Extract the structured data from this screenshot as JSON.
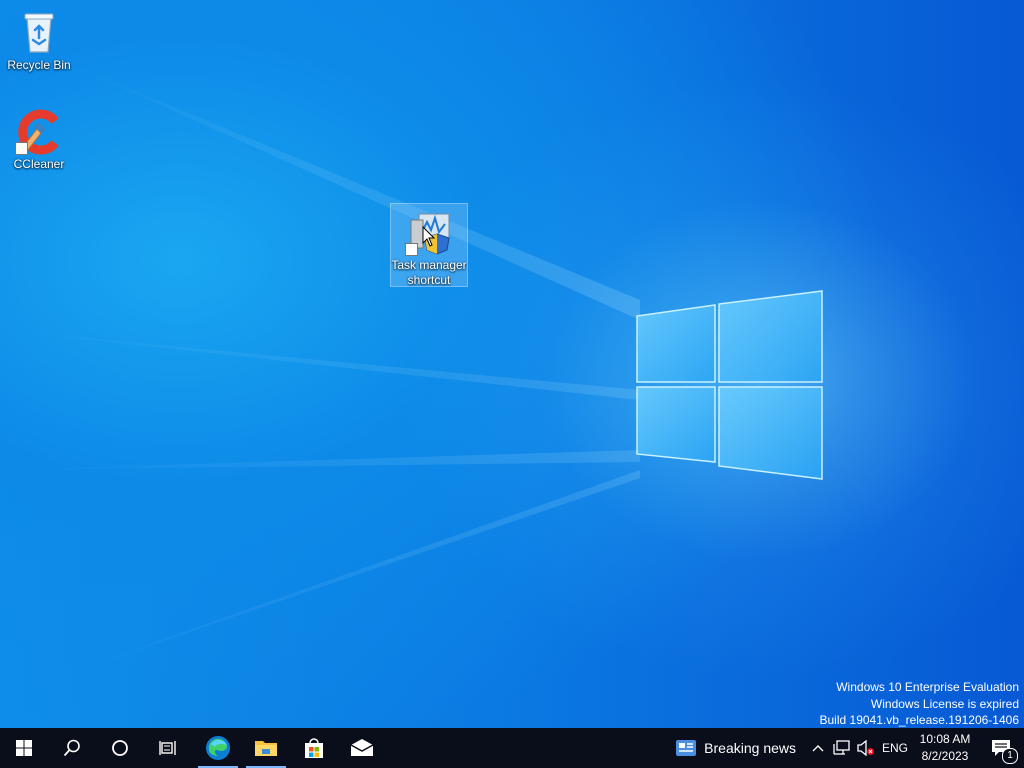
{
  "desktop": {
    "icons": [
      {
        "label": "Recycle Bin",
        "icon": "recycle-bin-icon"
      },
      {
        "label": "CCleaner",
        "icon": "ccleaner-icon"
      },
      {
        "label": "Task manager shortcut",
        "icon": "task-manager-icon"
      }
    ],
    "watermark": {
      "line1": "Windows 10 Enterprise Evaluation",
      "line2": "Windows License is expired",
      "line3": "Build 19041.vb_release.191206-1406"
    }
  },
  "taskbar": {
    "pinned": [
      {
        "name": "start",
        "icon": "windows-logo-icon"
      },
      {
        "name": "search",
        "icon": "search-icon"
      },
      {
        "name": "cortana",
        "icon": "circle-icon"
      },
      {
        "name": "task-view",
        "icon": "task-view-icon"
      },
      {
        "name": "edge",
        "icon": "edge-icon",
        "running": true
      },
      {
        "name": "file-explorer",
        "icon": "folder-icon",
        "running": true
      },
      {
        "name": "store",
        "icon": "store-bag-icon"
      },
      {
        "name": "mail",
        "icon": "mail-icon"
      }
    ],
    "news_label": "Breaking news",
    "language": "ENG",
    "time": "10:08 AM",
    "date": "8/2/2023",
    "notifications_count": "1"
  },
  "colors": {
    "taskbar": "#0a0d1a",
    "desktop_base": "#0b79e2",
    "accent": "#7fb7ff"
  }
}
